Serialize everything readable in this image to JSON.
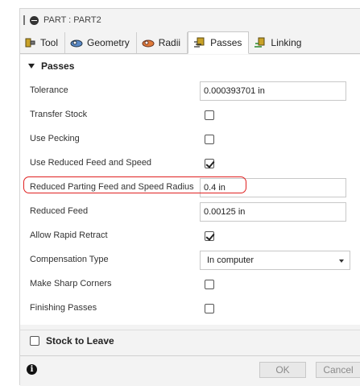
{
  "window": {
    "title": "PART : PART2"
  },
  "tabs": [
    {
      "label": "Tool",
      "active": false
    },
    {
      "label": "Geometry",
      "active": false
    },
    {
      "label": "Radii",
      "active": false
    },
    {
      "label": "Passes",
      "active": true
    },
    {
      "label": "Linking",
      "active": false
    }
  ],
  "section": {
    "title": "Passes"
  },
  "fields": {
    "tolerance": {
      "label": "Tolerance",
      "value": "0.000393701 in"
    },
    "transfer_stock": {
      "label": "Transfer Stock",
      "checked": false
    },
    "use_pecking": {
      "label": "Use Pecking",
      "checked": false
    },
    "use_reduced_feed": {
      "label": "Use Reduced Feed and Speed",
      "checked": true
    },
    "reduced_parting_radius": {
      "label": "Reduced Parting Feed and Speed Radius",
      "value": "0.4 in"
    },
    "reduced_feed": {
      "label": "Reduced Feed",
      "value": "0.00125 in"
    },
    "allow_rapid_retract": {
      "label": "Allow Rapid Retract",
      "checked": true
    },
    "compensation_type": {
      "label": "Compensation Type",
      "value": "In computer"
    },
    "make_sharp_corners": {
      "label": "Make Sharp Corners",
      "checked": false
    },
    "finishing_passes": {
      "label": "Finishing Passes",
      "checked": false
    }
  },
  "stock_to_leave": {
    "label": "Stock to Leave",
    "checked": false
  },
  "footer": {
    "ok_label": "OK",
    "cancel_label": "Cancel"
  },
  "colors": {
    "highlight": "#e02020",
    "panel": "#f3f3f3"
  }
}
